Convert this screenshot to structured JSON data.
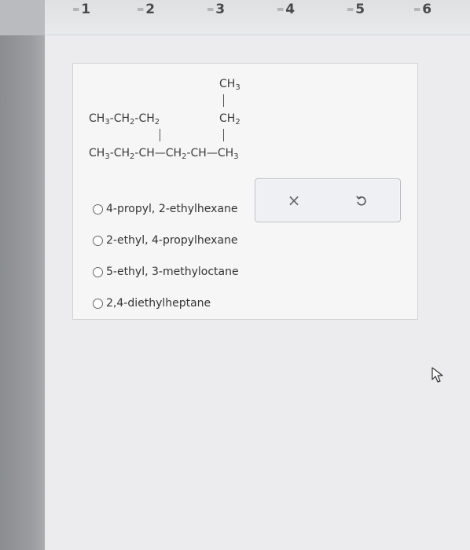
{
  "tabs": [
    {
      "label": "1"
    },
    {
      "label": "2"
    },
    {
      "label": "3"
    },
    {
      "label": "4"
    },
    {
      "label": "5"
    },
    {
      "label": "6"
    }
  ],
  "molecule": {
    "row1": {
      "ch3": "CH",
      "ch3_sub": "3"
    },
    "row2": {
      "left_a": "CH",
      "left_a_sub": "3",
      "left_b": "-CH",
      "left_b_sub": "2",
      "left_c": "-CH",
      "left_c_sub": "2",
      "right": "CH",
      "right_sub": "2"
    },
    "row3": {
      "a": "CH",
      "a_sub": "3",
      "b": "-CH",
      "b_sub": "2",
      "c": "-CH—CH",
      "c_sub": "2",
      "d": "-CH—CH",
      "d_sub": "3"
    }
  },
  "question": {
    "options": [
      {
        "label": "4-propyl, 2-ethylhexane"
      },
      {
        "label": "2-ethyl, 4-propylhexane"
      },
      {
        "label": "5-ethyl, 3-methyloctane"
      },
      {
        "label": "2,4-diethylheptane"
      }
    ]
  },
  "actions": {
    "clear_glyph": "×",
    "clear_icon": "close-icon",
    "undo_icon": "undo-icon"
  },
  "colors": {
    "text": "#333333",
    "card_bg": "#f6f6f7",
    "action_border": "#b9bdc3"
  }
}
